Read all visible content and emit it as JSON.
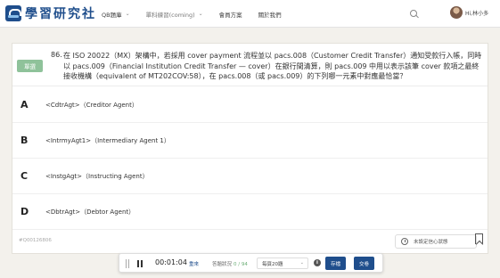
{
  "header": {
    "logo_text": "學習研究社",
    "nav": [
      {
        "label": "QB題庫",
        "has_dropdown": true
      },
      {
        "label": "單科練習(coming)",
        "has_dropdown": true
      },
      {
        "label": "會員方案",
        "has_dropdown": false
      },
      {
        "label": "關於我們",
        "has_dropdown": false
      }
    ],
    "user_name": "Hi,林小多"
  },
  "question": {
    "badge": "單選",
    "number": "86.",
    "text": "在 ISO 20022（MX）架構中，若採用 cover payment 流程並以 pacs.008（Customer Credit Transfer）通知受款行入帳，同時以 pacs.009（Financial Institution Credit Transfer — cover）在銀行間清算，則 pacs.009 中用以表示該筆 cover 款項之最終接收機構（equivalent of MT202COV:58），在 pacs.008（或 pacs.009）的下列哪一元素中對應最恰當？",
    "options": [
      {
        "letter": "A",
        "text": "<CdtrAgt>（Creditor Agent）"
      },
      {
        "letter": "B",
        "text": "<IntrmyAgt1>（Intermediary Agent 1）"
      },
      {
        "letter": "C",
        "text": "<InstgAgt>（Instructing Agent）"
      },
      {
        "letter": "D",
        "text": "<DbtrAgt>（Debtor Agent）"
      }
    ],
    "id": "#Q00126806",
    "confidence_placeholder": "未設定信心狀態"
  },
  "toolbar": {
    "timer": "00:01:04",
    "reset": "重來",
    "status_label": "答題狀況",
    "status_count": "0 / 94",
    "per_page": "每頁20題",
    "save": "存檔",
    "submit": "交卷"
  },
  "colors": {
    "brand": "#1f4e8c",
    "badge": "#8fc29a",
    "background": "#f3f1ec"
  }
}
